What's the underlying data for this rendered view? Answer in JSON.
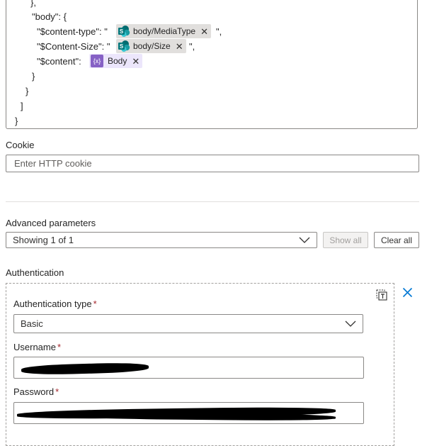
{
  "code": {
    "lines": [
      "},",
      "\"body\": {",
      "\"$content-type\": \"",
      "\",",
      "\"$Content-Size\": \"",
      "\",",
      "\"$content\":",
      "}",
      "}",
      "]",
      "}"
    ],
    "tokens": {
      "media_type": "body/MediaType",
      "size": "body/Size",
      "body": "Body"
    },
    "remove_glyph": "✕",
    "fx_glyph": "{x}"
  },
  "cookie": {
    "label": "Cookie",
    "placeholder": "Enter HTTP cookie"
  },
  "advanced": {
    "label": "Advanced parameters",
    "selected": "Showing 1 of 1",
    "show_all": "Show all",
    "clear_all": "Clear all"
  },
  "auth": {
    "label": "Authentication",
    "type_label": "Authentication type",
    "type_value": "Basic",
    "username_label": "Username",
    "password_label": "Password",
    "required_mark": "*"
  },
  "colors": {
    "accent": "#0078d4",
    "sharepoint": "#03787c",
    "expression": "#8661c5",
    "required": "#a4262c"
  }
}
